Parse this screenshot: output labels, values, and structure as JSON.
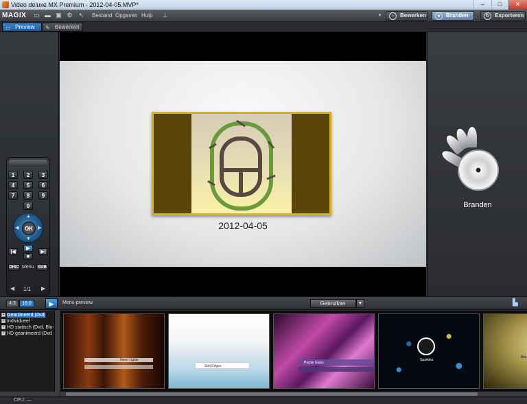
{
  "window": {
    "title": "Video deluxe MX Premium - 2012-04-05.MVP*",
    "minimize": "–",
    "maximize": "□",
    "close": "✕"
  },
  "menubar": {
    "logo": "MAGIX",
    "items": [
      "Bestand",
      "Opgaven",
      "Hulp"
    ],
    "modes": [
      {
        "label": "Bewerken",
        "icon": "film-icon"
      },
      {
        "label": "Branden",
        "icon": "disc-icon"
      },
      {
        "label": "Exporteren",
        "icon": "export-icon"
      }
    ],
    "active_mode": "Branden"
  },
  "subtabs": {
    "preview": "Preview",
    "bewerken": "Bewerken"
  },
  "remote": {
    "keys": [
      "1",
      "2",
      "3",
      "4",
      "5",
      "6",
      "7",
      "8",
      "9",
      "0"
    ],
    "ok": "OK",
    "disc": "DISC",
    "menu": "Menu",
    "sub": "SUB",
    "page": "1/1"
  },
  "preview": {
    "date": "2012-04-05"
  },
  "burn": {
    "label": "Branden"
  },
  "bottom": {
    "ratio_43": "4:3",
    "ratio_169": "16:9",
    "menu_preview": "Menu-preview",
    "gebruiken": "Gebruiken"
  },
  "tree": {
    "items": [
      {
        "label": "Geanimeerd (dvd)",
        "selected": true
      },
      {
        "label": "Individueel",
        "selected": false
      },
      {
        "label": "HD statisch (Dvd, Blu-",
        "selected": false
      },
      {
        "label": "HD geanimeerd (Dvd",
        "selected": false
      }
    ]
  },
  "templates": [
    {
      "name": "Neon Lights"
    },
    {
      "name": "Soft Edges"
    },
    {
      "name": "Purple Glass"
    },
    {
      "name": "Sparkles"
    },
    {
      "name": "Mar"
    }
  ],
  "status": {
    "cpu": "CPU: —"
  }
}
